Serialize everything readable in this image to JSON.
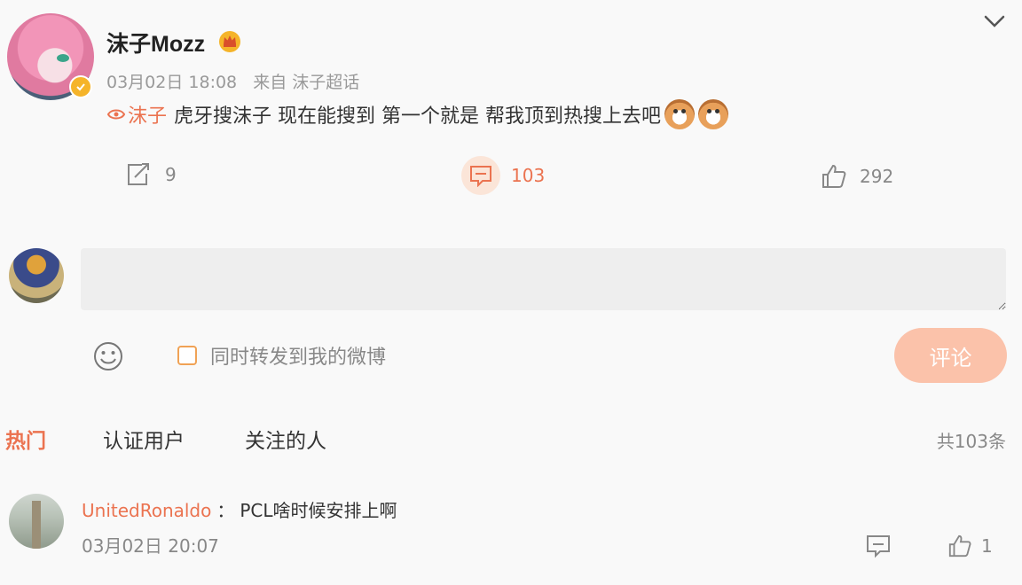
{
  "post": {
    "username": "沫子Mozz",
    "time": "03月02日 18:08",
    "source": "来自 沫子超话",
    "mention": "沫子",
    "text": "虎牙搜沫子 现在能搜到 第一个就是 帮我顶到热搜上去吧",
    "emoji_count": 2
  },
  "actions": {
    "repost_count": "9",
    "comment_count": "103",
    "like_count": "292"
  },
  "composer": {
    "placeholder": "",
    "forward_label": "同时转发到我的微博",
    "submit_label": "评论"
  },
  "tabs": {
    "hot": "热门",
    "verified": "认证用户",
    "following": "关注的人",
    "total": "共103条"
  },
  "reply": {
    "user": "UnitedRonaldo",
    "colon": "：",
    "text": "PCL啥时候安排上啊",
    "time": "03月02日 20:07",
    "like_count": "1"
  },
  "colors": {
    "accent": "#eb7350",
    "button": "#fbc2aa",
    "badge": "#f5b42a"
  },
  "icons": [
    "chevron-down-icon",
    "crown-icon",
    "verify-icon",
    "super-topic-icon",
    "repost-icon",
    "comment-icon",
    "like-icon",
    "smile-icon"
  ]
}
